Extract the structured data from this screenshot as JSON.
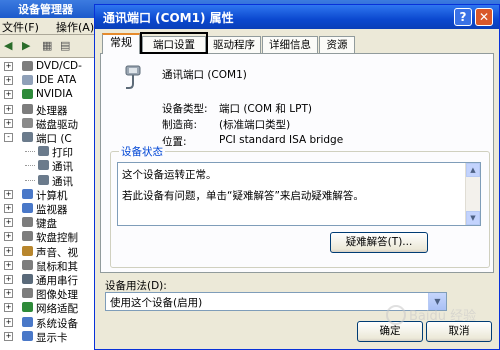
{
  "background_window": {
    "title": "设备管理器",
    "menu": [
      "文件(F)",
      "操作(A)"
    ],
    "tree_items": [
      {
        "label": "DVD/CD-",
        "indent": 1,
        "expander": "+",
        "color": "#7d7d7d"
      },
      {
        "label": "IDE ATA",
        "indent": 1,
        "expander": "+",
        "color": "#8fa0b8"
      },
      {
        "label": "NVIDIA",
        "indent": 1,
        "expander": "+",
        "color": "#2e8b3a"
      },
      {
        "label": "处理器",
        "indent": 1,
        "expander": "+",
        "color": "#7d7d7d"
      },
      {
        "label": "磁盘驱动",
        "indent": 1,
        "expander": "+",
        "color": "#8a8a8a"
      },
      {
        "label": "端口 (C",
        "indent": 1,
        "expander": "-",
        "color": "#6b7b8c"
      },
      {
        "label": "打印",
        "indent": 2,
        "expander": "",
        "color": "#6b7b8c"
      },
      {
        "label": "通讯",
        "indent": 2,
        "expander": "",
        "color": "#6b7b8c"
      },
      {
        "label": "通讯",
        "indent": 2,
        "expander": "",
        "color": "#6b7b8c"
      },
      {
        "label": "计算机",
        "indent": 1,
        "expander": "+",
        "color": "#4a78c8"
      },
      {
        "label": "监视器",
        "indent": 1,
        "expander": "+",
        "color": "#4a78c8"
      },
      {
        "label": "键盘",
        "indent": 1,
        "expander": "+",
        "color": "#7d7d7d"
      },
      {
        "label": "软盘控制",
        "indent": 1,
        "expander": "+",
        "color": "#7d7d7d"
      },
      {
        "label": "声音、视",
        "indent": 1,
        "expander": "+",
        "color": "#b8862d"
      },
      {
        "label": "鼠标和其",
        "indent": 1,
        "expander": "+",
        "color": "#7d7d7d"
      },
      {
        "label": "通用串行",
        "indent": 1,
        "expander": "+",
        "color": "#5a6a7a"
      },
      {
        "label": "图像处理",
        "indent": 1,
        "expander": "+",
        "color": "#7d7d7d"
      },
      {
        "label": "网络适配",
        "indent": 1,
        "expander": "+",
        "color": "#2e8b3a"
      },
      {
        "label": "系统设备",
        "indent": 1,
        "expander": "+",
        "color": "#4a78c8"
      },
      {
        "label": "显示卡",
        "indent": 1,
        "expander": "+",
        "color": "#4a78c8"
      }
    ]
  },
  "dialog": {
    "title": "通讯端口 (COM1) 属性",
    "help_label": "?",
    "close_label": "✕",
    "tabs": [
      "常规",
      "端口设置",
      "驱动程序",
      "详细信息",
      "资源"
    ],
    "active_tab": "常规",
    "device_name": "通讯端口 (COM1)",
    "device_type_label": "设备类型:",
    "device_type_value": "端口 (COM 和 LPT)",
    "manufacturer_label": "制造商:",
    "manufacturer_value": "(标准端口类型)",
    "location_label": "位置:",
    "location_value": "PCI standard ISA bridge",
    "status_group_label": "设备状态",
    "status_line1": "这个设备运转正常。",
    "status_line2": "若此设备有问题，单击“疑难解答”来启动疑难解答。",
    "troubleshoot_button": "疑难解答(T)...",
    "usage_label": "设备用法(D):",
    "usage_value": "使用这个设备(启用)",
    "ok_button": "确定",
    "cancel_button": "取消"
  },
  "watermark": "Baidu 经验",
  "colors": {
    "titlebar": "#0b48cf",
    "dialog_bg": "#ece9d8",
    "group_label": "#0046d5",
    "tab_accent": "#e68b2c"
  }
}
